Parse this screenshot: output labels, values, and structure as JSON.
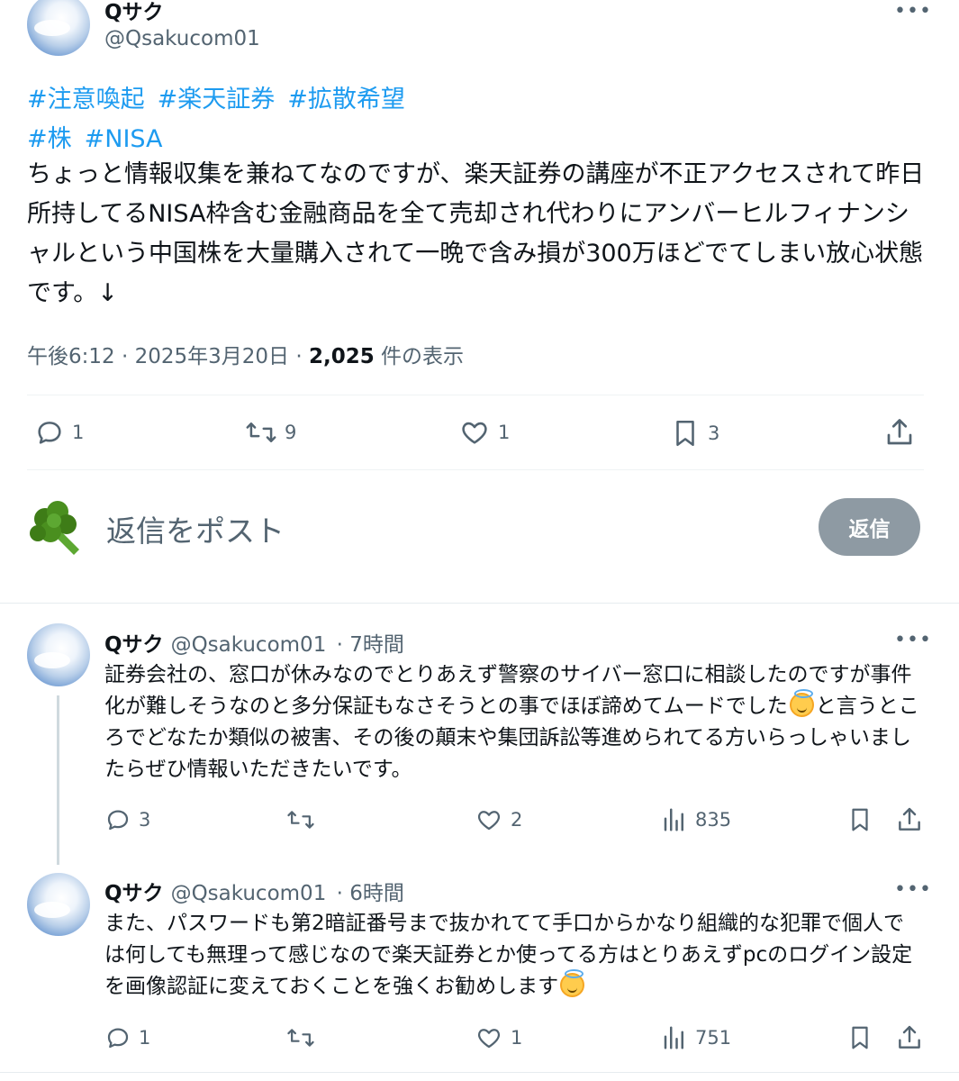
{
  "main_tweet": {
    "display_name": "Qサク",
    "handle": "@Qsakucom01",
    "hashtags_line1": [
      "#注意喚起",
      "#楽天証券",
      "#拡散希望"
    ],
    "hashtags_line2": [
      "#株",
      "#NISA"
    ],
    "text": "ちょっと情報収集を兼ねてなのですが、楽天証券の講座が不正アクセスされて昨日所持してるNISA枠含む金融商品を全て売却され代わりにアンバーヒルフィナンシャルという中国株を大量購入されて一晩で含み損が300万ほどでてしまい放心状態です。↓",
    "time": "午後6:12",
    "date": "2025年3月20日",
    "views": "2,025",
    "views_label": "件の表示",
    "separator": "·",
    "actions": {
      "replies": "1",
      "retweets": "9",
      "likes": "1",
      "bookmarks": "3"
    }
  },
  "reply_box": {
    "placeholder": "返信をポスト",
    "button_label": "返信",
    "avatar_icon": "broccoli-icon"
  },
  "replies": [
    {
      "display_name": "Qサク",
      "handle": "@Qsakucom01",
      "time": "· 7時間",
      "text_before_emoji": "証券会社の、窓口が休みなのでとりあえず警察のサイバー窓口に相談したのですが事件化が難しそうなのと多分保証もなさそうとの事でほぼ諦めてムードでした",
      "text_after_emoji": "と言うところでどなたか類似の被害、その後の顛末や集団訴訟等進められてる方いらっしゃいましたらぜひ情報いただきたいです。",
      "emoji_icon": "smiling-face-with-halo-icon",
      "actions": {
        "replies": "3",
        "retweets": "",
        "likes": "2",
        "views": "835"
      }
    },
    {
      "display_name": "Qサク",
      "handle": "@Qsakucom01",
      "time": "· 6時間",
      "text_before_emoji": "また、パスワードも第2暗証番号まで抜かれてて手口からかなり組織的な犯罪で個人では何しても無理って感じなので楽天証券とか使ってる方はとりあえずpcのログイン設定を画像認証に変えておくことを強くお勧めします",
      "text_after_emoji": "",
      "emoji_icon": "smiling-face-with-halo-icon",
      "actions": {
        "replies": "1",
        "retweets": "",
        "likes": "1",
        "views": "751"
      }
    }
  ],
  "colors": {
    "link": "#1d9bf0",
    "muted": "#536471",
    "text": "#0f1419",
    "reply_button_disabled": "#8e9aa3"
  }
}
